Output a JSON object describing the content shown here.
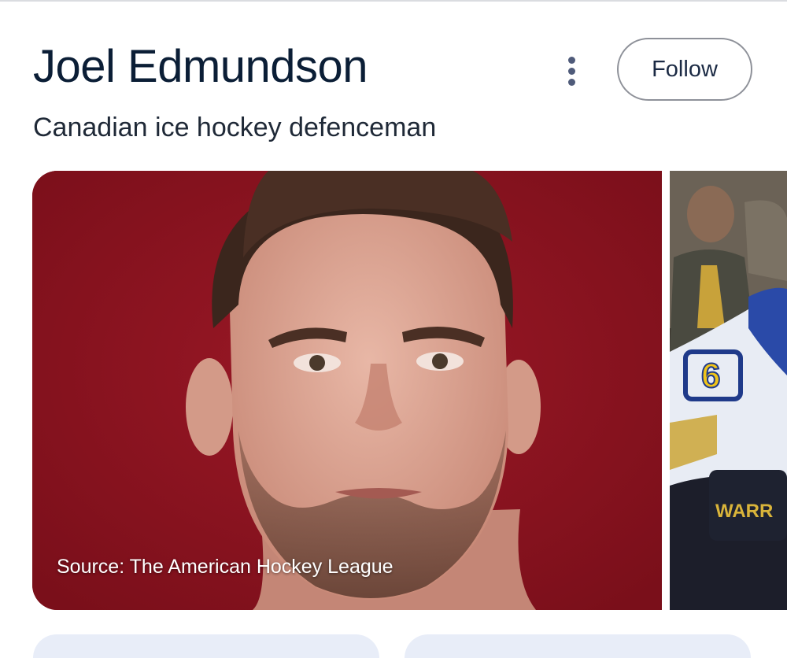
{
  "entity": {
    "title": "Joel Edmundson",
    "subtitle": "Canadian ice hockey defenceman"
  },
  "actions": {
    "follow_label": "Follow",
    "more_icon": "more-vert-icon"
  },
  "images": [
    {
      "source_label": "Source: The American Hockey League",
      "description": "portrait photo of player on red background"
    },
    {
      "description": "game action photo of player in white and blue jersey"
    }
  ],
  "colors": {
    "title": "#0b1e36",
    "follow_border": "#8e9199",
    "chip_background": "#e8edf8",
    "photo_background": "#8c1420"
  }
}
